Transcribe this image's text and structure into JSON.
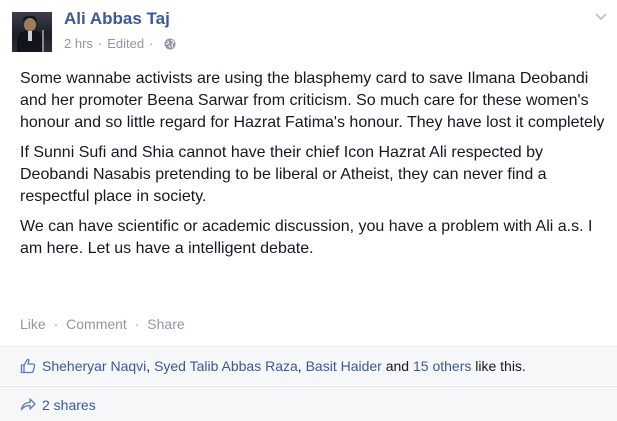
{
  "post": {
    "author": "Ali Abbas Taj",
    "time": "2 hrs",
    "separator": "·",
    "edited": "Edited",
    "privacy_icon": "globe-icon",
    "paragraphs": [
      "Some wannabe activists are using the blasphemy card to save Ilmana Deobandi and her promoter Beena Sarwar from criticism. So much care for these women's honour and so little regard for Hazrat Fatima's honour. They have lost it completely",
      "If Sunni Sufi and Shia cannot have their chief Icon Hazrat Ali respected by Deobandi Nasabis pretending to be liberal or Atheist, they can never find a respectful place in society.",
      "We can have scientific or academic discussion, you have a problem with Ali a.s. I am here. Let us have a intelligent debate."
    ]
  },
  "actions": {
    "like": "Like",
    "comment": "Comment",
    "share": "Share",
    "dot": "·"
  },
  "likes": {
    "people": [
      "Sheheryar Naqvi",
      "Syed Talib Abbas Raza",
      "Basit Haider"
    ],
    "comma": ", ",
    "and": " and ",
    "others": "15 others",
    "suffix": " like this."
  },
  "shares": {
    "label": "2 shares"
  },
  "colors": {
    "link": "#3b5998",
    "meta": "#9197a3",
    "text": "#141823",
    "footer_bg": "#f6f7f8"
  }
}
